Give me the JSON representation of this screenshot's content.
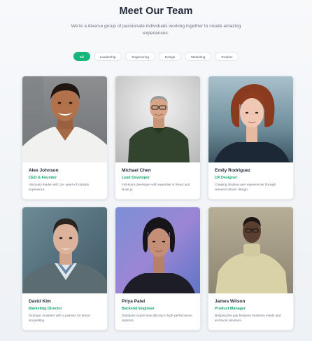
{
  "header": {
    "title": "Meet Our Team",
    "subtitle": "We're a diverse group of passionate individuals working together to create amazing experiences."
  },
  "filters": [
    "All",
    "Leadership",
    "Engineering",
    "Design",
    "Marketing",
    "Product"
  ],
  "active_filter": "All",
  "colors": {
    "accent": "#19b67c",
    "role_text": "#16a86f",
    "title": "#1e2636"
  },
  "members": [
    {
      "name": "Alex Johnson",
      "role": "CEO & Founder",
      "bio": "Visionary leader with 15+ years of industry experience."
    },
    {
      "name": "Michael Chen",
      "role": "Lead Developer",
      "bio": "Full-stack developer with expertise in React and Node.js."
    },
    {
      "name": "Emily Rodriguez",
      "role": "UX Designer",
      "bio": "Creating intuitive user experiences through research-driven design."
    },
    {
      "name": "David Kim",
      "role": "Marketing Director",
      "bio": "Strategic marketer with a passion for brand storytelling."
    },
    {
      "name": "Priya Patel",
      "role": "Backend Engineer",
      "bio": "Database expert specializing in high-performance systems."
    },
    {
      "name": "James Wilson",
      "role": "Product Manager",
      "bio": "Bridging the gap between business needs and technical solutions."
    }
  ]
}
